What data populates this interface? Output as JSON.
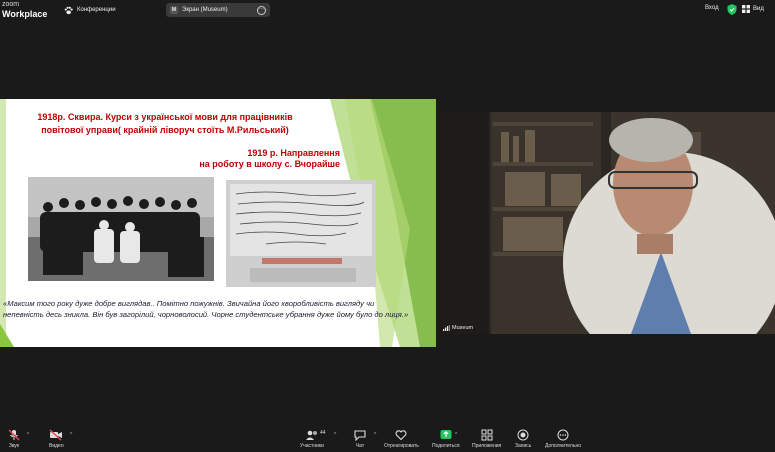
{
  "app": {
    "logo_line1": "zoom",
    "logo_line2": "Workplace"
  },
  "topbar": {
    "conference_label": "Конференции",
    "screen_badge": "M",
    "screen_label": "Экран (Museum)",
    "signin": "Вход",
    "view": "Вид"
  },
  "slide": {
    "title_line1": "1918р. Сквира. Курси з української мови для працівників",
    "title_line2": "повітової управи( крайній ліворуч стоїть М.Рильський)",
    "sub_line1": "1919 р. Направлення",
    "sub_line2": "на роботу в школу с. Вчорайше",
    "quote": "«Максим того року   дуже добре виглядав.. Помітно пожужнів. Звичайна його хворобливість вигляду чи непевність десь зникла. Він був загорілий, чорноволосий. Чорне студентське убрання дуже йому було до лиця.»"
  },
  "camera": {
    "name": "Museum"
  },
  "toolbar": {
    "audio": "Звук",
    "video": "Видео",
    "participants": "Участники",
    "participants_count": "44",
    "chat": "Чат",
    "react": "Отреагировать",
    "share": "Поделиться",
    "apps": "Приложения",
    "record": "Запись",
    "more": "Дополнительно"
  },
  "colors": {
    "accent_red": "#c00000",
    "share_green": "#22c55e",
    "mute_red": "#e5484d",
    "slide_green": "#8cc63f"
  }
}
